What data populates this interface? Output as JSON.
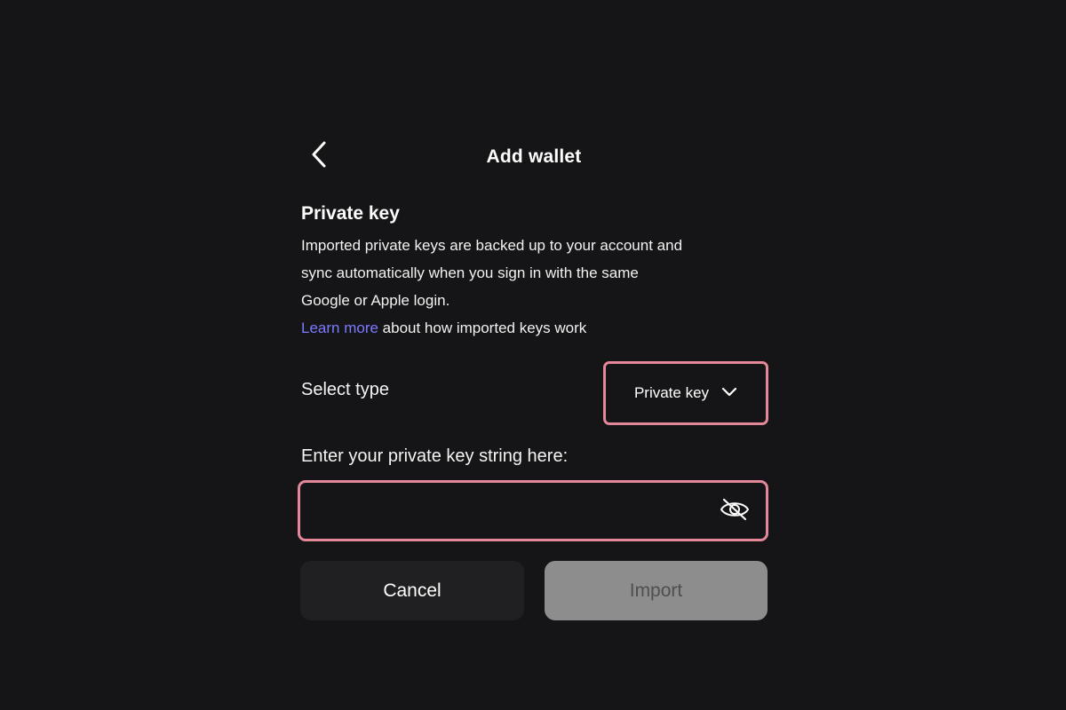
{
  "header": {
    "title": "Add wallet",
    "back_icon": "chevron-left-icon"
  },
  "section": {
    "title": "Private key",
    "description_lines": [
      "Imported private keys are backed up to your account and",
      "sync automatically when you sign in with the same",
      "Google or Apple login."
    ],
    "learn_more_link": "Learn more",
    "learn_more_suffix": " about how imported keys work"
  },
  "type_select": {
    "label": "Select type",
    "selected_value": "Private key",
    "icon": "chevron-down-icon"
  },
  "key_input": {
    "label": "Enter your private key string here:",
    "value": "",
    "visibility_icon": "eye-slash-icon"
  },
  "actions": {
    "cancel_label": "Cancel",
    "import_label": "Import",
    "import_enabled": false
  },
  "colors": {
    "background": "#151517",
    "highlight_border": "#e2889a",
    "link": "#7b7bff",
    "cancel_bg": "#202022",
    "import_bg_disabled": "#8d8d8d"
  }
}
